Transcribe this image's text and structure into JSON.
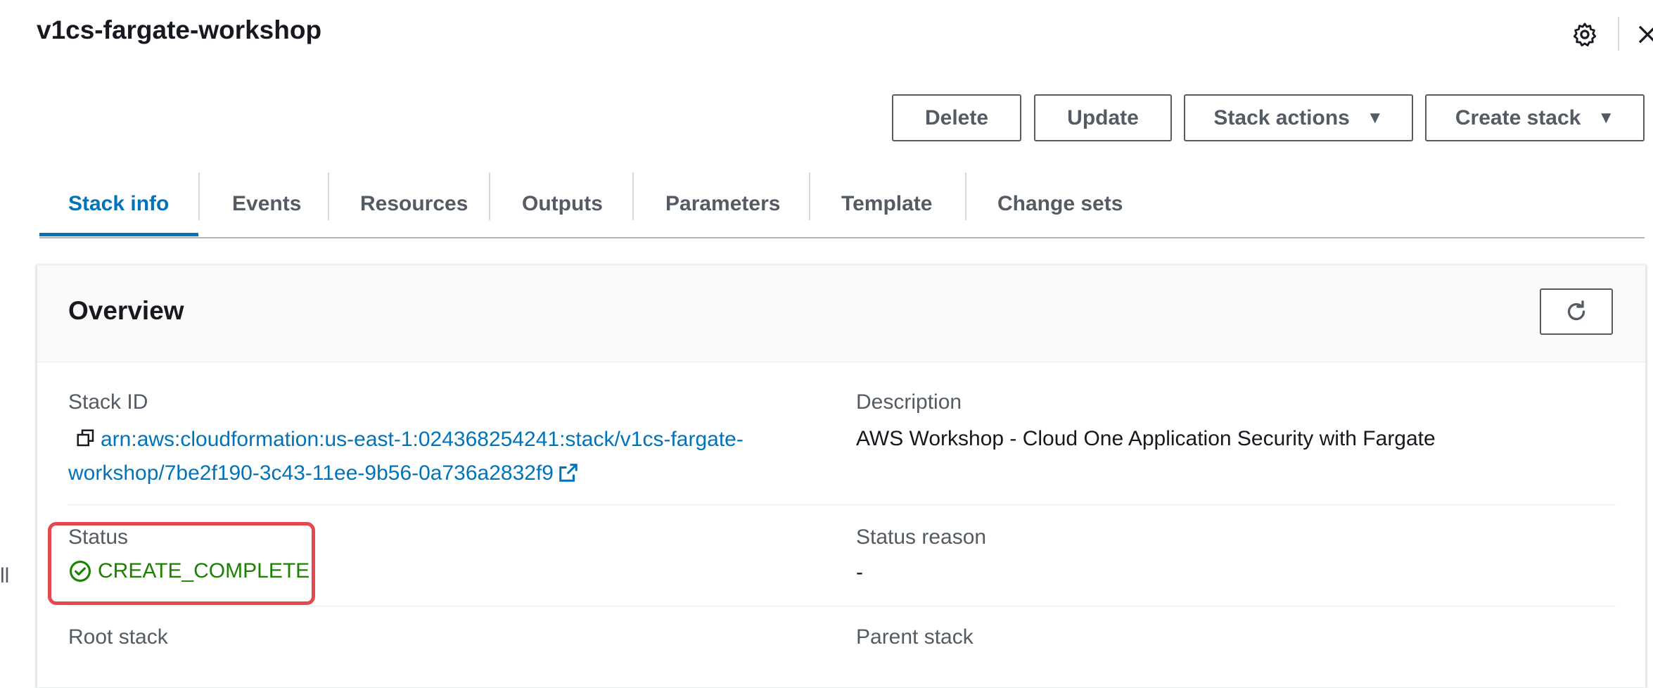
{
  "header": {
    "title": "v1cs-fargate-workshop",
    "icons": [
      "settings-icon",
      "close-icon"
    ]
  },
  "actions": {
    "delete": "Delete",
    "update": "Update",
    "stack_actions": "Stack actions",
    "create_stack": "Create stack",
    "caret": "▼"
  },
  "tabs": [
    {
      "label": "Stack info",
      "active": true
    },
    {
      "label": "Events"
    },
    {
      "label": "Resources"
    },
    {
      "label": "Outputs"
    },
    {
      "label": "Parameters"
    },
    {
      "label": "Template"
    },
    {
      "label": "Change sets"
    }
  ],
  "overview": {
    "title": "Overview",
    "stack_id": {
      "label": "Stack ID",
      "value": "arn:aws:cloudformation:us-east-1:024368254241:stack/v1cs-fargate-workshop/7be2f190-3c43-11ee-9b56-0a736a2832f9"
    },
    "description": {
      "label": "Description",
      "value": "AWS Workshop - Cloud One Application Security with Fargate"
    },
    "status": {
      "label": "Status",
      "value": "CREATE_COMPLETE"
    },
    "status_reason": {
      "label": "Status reason",
      "value": "-"
    },
    "root_stack": {
      "label": "Root stack"
    },
    "parent_stack": {
      "label": "Parent stack"
    }
  },
  "side_mark": "ll",
  "colors": {
    "link": "#0073bb",
    "success": "#1d8102",
    "highlight": "#e5484f",
    "text": "#16191f",
    "secondary_text": "#545b64"
  }
}
